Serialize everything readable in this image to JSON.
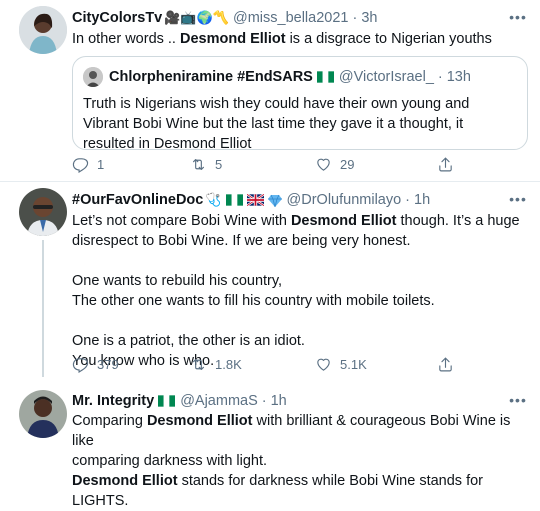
{
  "tweets": [
    {
      "name": "CityColorsTv",
      "name_emojis": "🎥📺🌍〽️",
      "handle": "@miss_bella2021",
      "time": "3h",
      "text_parts": [
        {
          "t": "In other words .. ",
          "bold": false
        },
        {
          "t": "Desmond Elliot",
          "bold": true
        },
        {
          "t": " is a disgrace to Nigerian youths",
          "bold": false
        }
      ],
      "quote": {
        "name": "Chlorpheniramine #EndSARS",
        "handle": "@VictorIsrael_",
        "time": "13h",
        "text": "Truth is Nigerians wish they could have their own young and Vibrant Bobi Wine but the last time they gave it a thought, it resulted in Desmond Elliot"
      },
      "replies": "1",
      "retweets": "5",
      "likes": "29"
    },
    {
      "name": "#OurFavOnlineDoc",
      "name_emojis": "🩺",
      "handle": "@DrOlufunmilayo",
      "time": "1h",
      "line1_parts": [
        {
          "t": "Let’s not compare Bobi Wine with ",
          "bold": false
        },
        {
          "t": "Desmond Elliot",
          "bold": true
        },
        {
          "t": " though. It’s a huge",
          "bold": false
        }
      ],
      "line2": "disrespect to Bobi Wine. If we are being very honest.",
      "line3": "One wants to rebuild his country,",
      "line4": "The other one wants to fill his country with mobile toilets.",
      "line5": "One is a patriot, the other is an idiot.",
      "line6": "You know who is who.",
      "replies": "379",
      "retweets": "1.8K",
      "likes": "5.1K"
    },
    {
      "name": "Mr. Integrity",
      "handle": "@AjammaS",
      "time": "1h",
      "l1a": "Comparing ",
      "l1b": "Desmond Elliot",
      "l1c": " with brilliant & courageous Bobi Wine is like",
      "l2": "comparing darkness with light.",
      "l3a": "Desmond Elliot",
      "l3b": " stands for darkness while Bobi Wine stands for LIGHTS."
    }
  ],
  "separator": "·",
  "more_icon": "•••",
  "icons": [
    "reply-icon",
    "retweet-icon",
    "like-icon",
    "share-icon"
  ],
  "colors": {
    "text": "#0f1419",
    "muted": "#5b7083",
    "border": "#e6ecf0",
    "flag_green": "#008751"
  }
}
